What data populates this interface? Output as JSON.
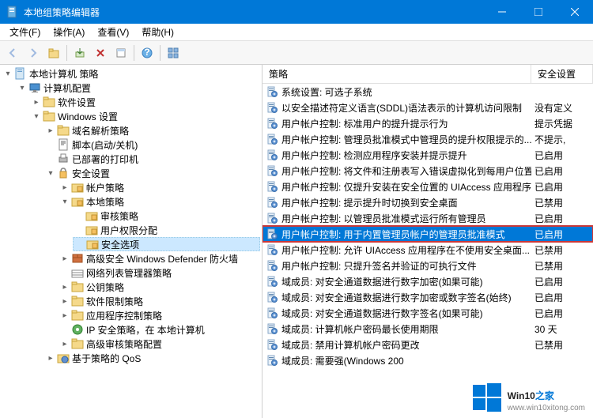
{
  "window": {
    "title": "本地组策略编辑器"
  },
  "menu": {
    "file": "文件(F)",
    "action": "操作(A)",
    "view": "查看(V)",
    "help": "帮助(H)"
  },
  "tree": {
    "root": "本地计算机 策略",
    "computer_config": "计算机配置",
    "software_settings": "软件设置",
    "windows_settings": "Windows 设置",
    "name_resolution": "域名解析策略",
    "scripts": "脚本(启动/关机)",
    "deployed_printers": "已部署的打印机",
    "security_settings": "安全设置",
    "account_policies": "帐户策略",
    "local_policies": "本地策略",
    "audit_policy": "审核策略",
    "user_rights": "用户权限分配",
    "security_options": "安全选项",
    "windows_defender": "高级安全 Windows Defender 防火墙",
    "network_list": "网络列表管理器策略",
    "public_key": "公钥策略",
    "software_restriction": "软件限制策略",
    "app_control": "应用程序控制策略",
    "ip_security": "IP 安全策略，在 本地计算机",
    "advanced_audit": "高级审核策略配置",
    "qos": "基于策略的 QoS"
  },
  "list": {
    "header_name": "策略",
    "header_setting": "安全设置",
    "items": [
      {
        "name": "系统设置: 可选子系统",
        "setting": ""
      },
      {
        "name": "以安全描述符定义语言(SDDL)语法表示的计算机访问限制",
        "setting": "没有定义"
      },
      {
        "name": "用户帐户控制: 标准用户的提升提示行为",
        "setting": "提示凭据"
      },
      {
        "name": "用户帐户控制: 管理员批准模式中管理员的提升权限提示的...",
        "setting": "不提示,"
      },
      {
        "name": "用户帐户控制: 检测应用程序安装并提示提升",
        "setting": "已启用"
      },
      {
        "name": "用户帐户控制: 将文件和注册表写入错误虚拟化到每用户位置",
        "setting": "已启用"
      },
      {
        "name": "用户帐户控制: 仅提升安装在安全位置的 UIAccess 应用程序",
        "setting": "已启用"
      },
      {
        "name": "用户帐户控制: 提示提升时切换到安全桌面",
        "setting": "已禁用"
      },
      {
        "name": "用户帐户控制: 以管理员批准模式运行所有管理员",
        "setting": "已启用"
      },
      {
        "name": "用户帐户控制: 用于内置管理员帐户的管理员批准模式",
        "setting": "已启用",
        "selected": true
      },
      {
        "name": "用户帐户控制: 允许 UIAccess 应用程序在不使用安全桌面...",
        "setting": "已禁用"
      },
      {
        "name": "用户帐户控制: 只提升签名并验证的可执行文件",
        "setting": "已禁用"
      },
      {
        "name": "域成员: 对安全通道数据进行数字加密(如果可能)",
        "setting": "已启用"
      },
      {
        "name": "域成员: 对安全通道数据进行数字加密或数字签名(始终)",
        "setting": "已启用"
      },
      {
        "name": "域成员: 对安全通道数据进行数字签名(如果可能)",
        "setting": "已启用"
      },
      {
        "name": "域成员: 计算机帐户密码最长使用期限",
        "setting": "30 天"
      },
      {
        "name": "域成员: 禁用计算机帐户密码更改",
        "setting": "已禁用"
      },
      {
        "name": "域成员: 需要强(Windows 200",
        "setting": ""
      }
    ]
  },
  "watermark": {
    "main_prefix": "Win10",
    "main_suffix": "之家",
    "sub": "www.win10xitong.com"
  }
}
